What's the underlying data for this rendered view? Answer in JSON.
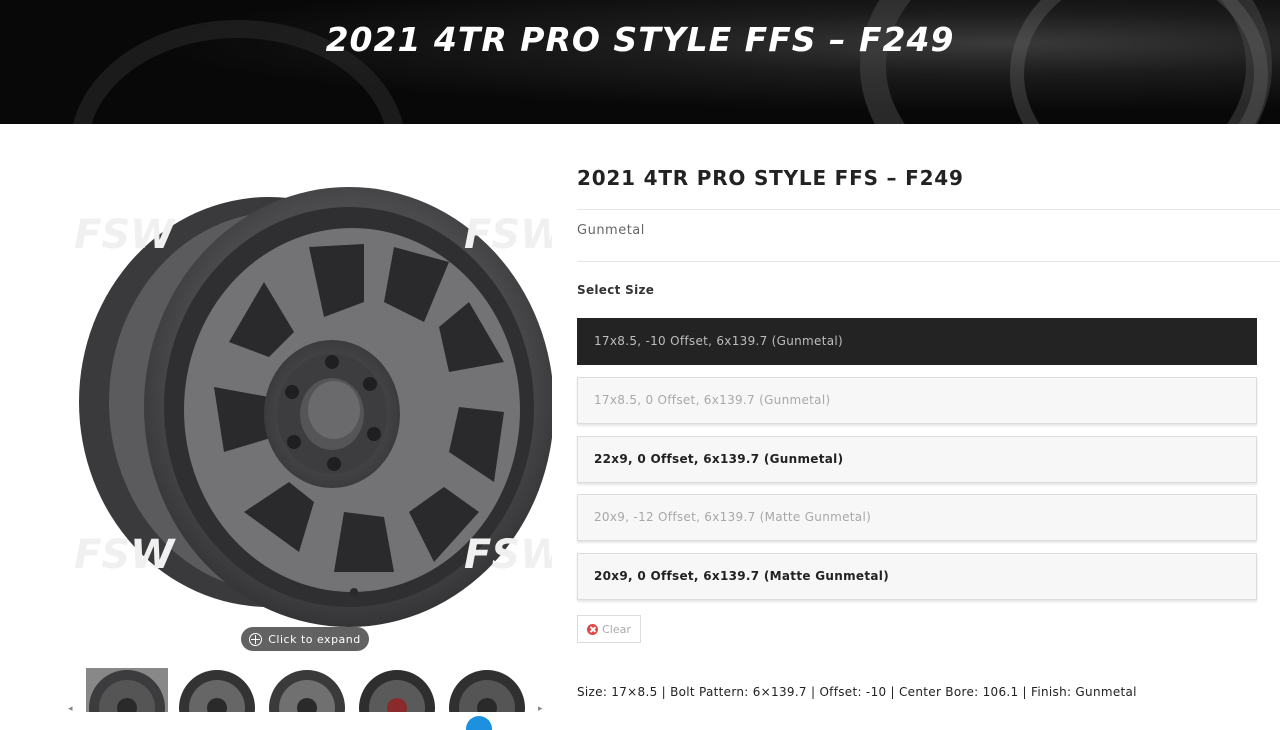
{
  "hero": {
    "title": "2021 4TR PRO STYLE FFS – F249"
  },
  "gallery": {
    "expand_label": "Click to expand",
    "thumbnail_count": 5,
    "active_thumbnail": 1
  },
  "product": {
    "title": "2021 4TR PRO STYLE FFS – F249",
    "finish": "Gunmetal",
    "select_label": "Select Size",
    "options": [
      {
        "label": "17x8.5, -10 Offset, 6x139.7 (Gunmetal)",
        "state": "selected"
      },
      {
        "label": "17x8.5, 0 Offset, 6x139.7 (Gunmetal)",
        "state": "disabled"
      },
      {
        "label": "22x9, 0 Offset, 6x139.7 (Gunmetal)",
        "state": "available"
      },
      {
        "label": "20x9, -12 Offset, 6x139.7 (Matte Gunmetal)",
        "state": "disabled"
      },
      {
        "label": "20x9, 0 Offset, 6x139.7 (Matte Gunmetal)",
        "state": "available"
      }
    ],
    "clear_label": "Clear",
    "spec_line": "Size: 17×8.5 | Bolt Pattern: 6×139.7 | Offset: -10 | Center Bore: 106.1 | Finish: Gunmetal"
  },
  "colors": {
    "selected_option_bg": "#232323",
    "clear_icon": "#e04848",
    "wheel_gunmetal": "#4a4a4c",
    "scroll_button": "#1e90e0"
  }
}
